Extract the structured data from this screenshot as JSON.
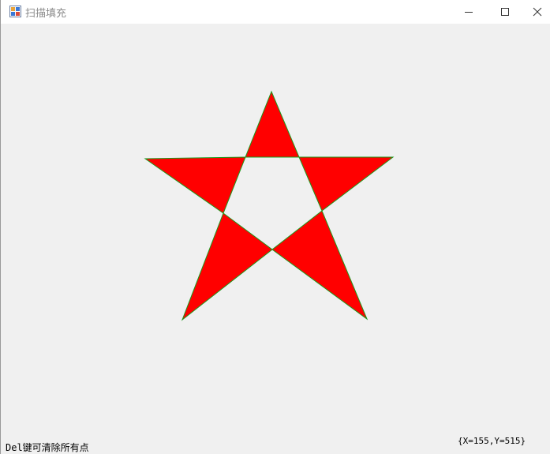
{
  "window": {
    "title": "扫描填充",
    "icon": "app-form-icon",
    "controls": {
      "minimize_icon": "minimize-icon",
      "maximize_icon": "maximize-icon",
      "close_icon": "close-icon"
    }
  },
  "canvas": {
    "shape": "five-pointed-star",
    "fill_color": "#ff0000",
    "edge_color": "#00a000",
    "background": "#f0f0f0"
  },
  "status": {
    "hint": "Del键可清除所有点",
    "cursor_position": "{X=155,Y=515}"
  }
}
